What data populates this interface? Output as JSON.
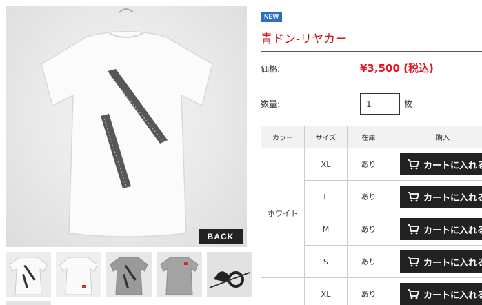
{
  "gallery": {
    "main_badge": "BACK",
    "thumbnails": [
      {
        "name": "white-tee-back"
      },
      {
        "name": "white-tee-front"
      },
      {
        "name": "gray-tee-back"
      },
      {
        "name": "gray-tee-front"
      },
      {
        "name": "print-detail"
      }
    ]
  },
  "product": {
    "badge": "NEW",
    "title": "青ドン-リヤカー",
    "price_label": "価格:",
    "price_value": "¥3,500 (税込)",
    "qty_label": "数量:",
    "qty_value": "1",
    "qty_unit": "枚"
  },
  "table": {
    "headers": {
      "color": "カラー",
      "size": "サイズ",
      "stock": "在庫",
      "buy": "購入"
    },
    "group_color": "ホワイト",
    "rows": [
      {
        "size": "XL",
        "stock": "あり",
        "button": "カートに入れる"
      },
      {
        "size": "L",
        "stock": "あり",
        "button": "カートに入れる"
      },
      {
        "size": "M",
        "stock": "あり",
        "button": "カートに入れる"
      },
      {
        "size": "S",
        "stock": "あり",
        "button": "カートに入れる"
      },
      {
        "size": "XL",
        "stock": "あり",
        "button": "カートに入れる"
      }
    ]
  },
  "colors": {
    "accent_red": "#d0121b",
    "price_red": "#e8141e",
    "badge_blue": "#2a6ec6",
    "button_dark": "#222222"
  }
}
